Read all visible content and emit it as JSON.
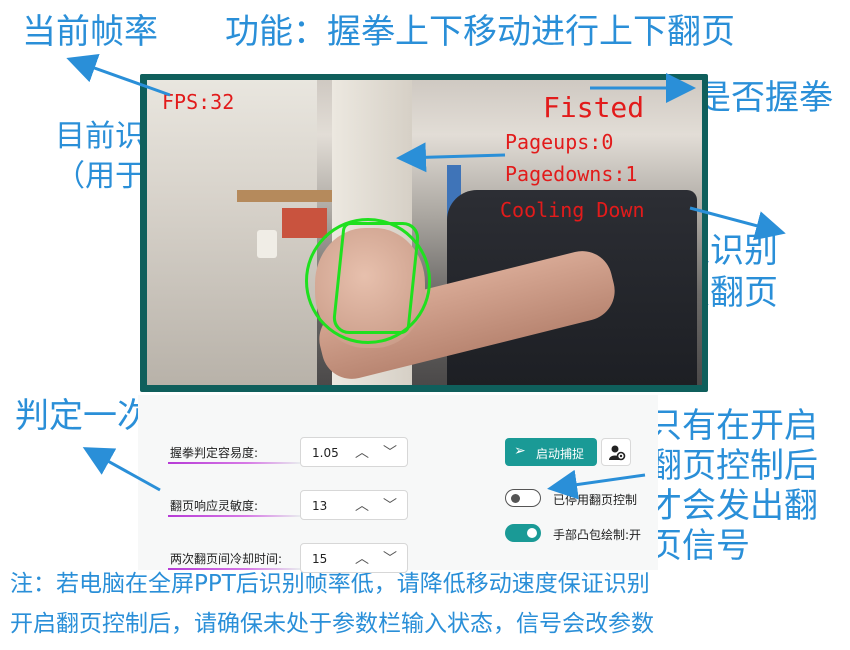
{
  "annotations": {
    "current_fps": "当前帧率",
    "feature": "功能：握拳上下移动进行上下翻页",
    "fisted": "是否握拳",
    "count_line1": "目前识别到的翻页次数",
    "count_line2": "（用于测试调试）",
    "cooldown_line1": "一次翻页后进入识别",
    "cooldown_line2": "冷却，避免多次翻页",
    "sensitivity": "判定一次翻页的移动灵敏度",
    "signal_line1": "只有在开启",
    "signal_line2": "翻页控制后",
    "signal_line3": "才会发出翻",
    "signal_line4": "页信号",
    "note_line1": "注：若电脑在全屏PPT后识别帧率低，请降低移动速度保证识别",
    "note_line2": "开启翻页控制后，请确保未处于参数栏输入状态，信号会改参数"
  },
  "camera_overlay": {
    "fps": "FPS:32",
    "fisted": "Fisted",
    "pageups": "Pageups:0",
    "pagedowns": "Pagedowns:1",
    "cooling": "Cooling Down"
  },
  "controls": {
    "fist_ease_label": "握拳判定容易度:",
    "fist_ease_value": "1.05",
    "page_sensitivity_label": "翻页响应灵敏度:",
    "page_sensitivity_value": "13",
    "cooldown_label": "两次翻页间冷却时间:",
    "cooldown_value": "15",
    "start_button": "启动捕捉",
    "page_control_toggle": "已停用翻页控制",
    "hull_draw_toggle": "手部凸包绘制:开"
  },
  "icons": {
    "start": "send-icon",
    "settings": "person-settings-icon"
  },
  "colors": {
    "annotation": "#2a8fd8",
    "overlay_text": "#e21b1b",
    "detection": "#1fe01f",
    "accent": "#1a9a96"
  }
}
